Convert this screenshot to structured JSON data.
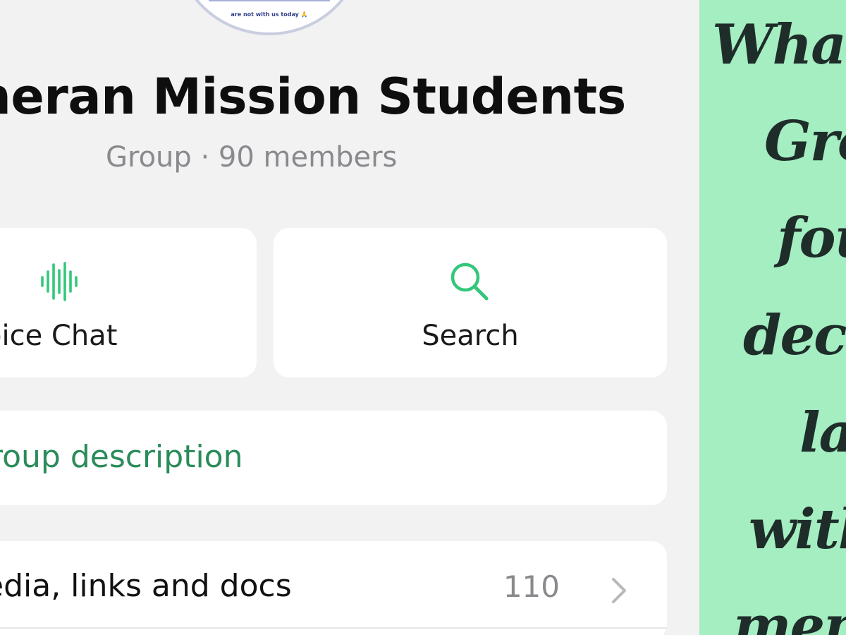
{
  "avatar": {
    "caption": "are not with us today 🙏"
  },
  "group": {
    "name": "heran Mission Students",
    "meta": "Group · 90 members"
  },
  "actions": {
    "voice_chat": "oice Chat",
    "search": "Search"
  },
  "description": {
    "label": "roup description"
  },
  "media": {
    "label": "edia, links and docs",
    "count": "110"
  },
  "banner": {
    "lines": [
      "What",
      "Gro",
      "fou",
      "deca",
      "lat",
      "with",
      "mem"
    ]
  },
  "colors": {
    "accent_green": "#2a8c5a",
    "icon_green": "#34c77b",
    "banner_bg": "#a4eec2",
    "page_bg": "#f2f2f3"
  },
  "icons": {
    "voice": "waveform-icon",
    "search": "magnifier-icon",
    "chevron": "chevron-right-icon"
  }
}
